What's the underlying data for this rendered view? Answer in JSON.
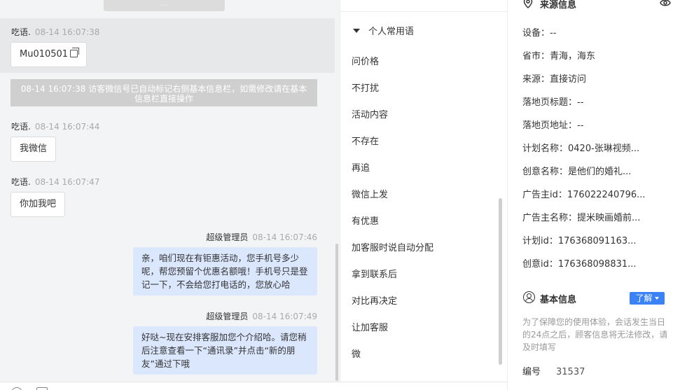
{
  "chat": {
    "top_pill": "...",
    "messages": [
      {
        "sender": "吃语.",
        "time": "08-14 16:07:38",
        "text": "Mu010501"
      },
      {
        "system": "08-14 16:07:38 访客微信号已自动标记右侧基本信息栏，如需修改请在基本信息栏直接操作"
      },
      {
        "sender": "吃语.",
        "time": "08-14 16:07:44",
        "text": "我微信"
      },
      {
        "sender": "吃语.",
        "time": "08-14 16:07:47",
        "text": "你加我吧"
      },
      {
        "sender": "超级管理员",
        "time": "08-14 16:07:46",
        "text": "亲，咱们现在有钜惠活动，您手机号多少呢，帮您预留个优惠名额哦！手机号只是登记一下，不会给您打电话的，您放心哈"
      },
      {
        "sender": "超级管理员",
        "time": "08-14 16:07:49",
        "text": "好哒~现在安排客服加您个介绍哈。请您稍后注意查看一下“通讯录”并点击“新的朋友”通过下哦"
      }
    ]
  },
  "phrases": {
    "group_title": "个人常用语",
    "items": [
      "问价格",
      "不打扰",
      "活动内容",
      "不存在",
      "再追",
      "微信上发",
      "有优惠",
      "加客服时说自动分配",
      "拿到联系后",
      "对比再决定",
      "让加客服",
      "微"
    ]
  },
  "info": {
    "source_title": "来源信息",
    "rows": [
      {
        "label": "设备：",
        "value": "--"
      },
      {
        "label": "省市：",
        "value": "青海，海东"
      },
      {
        "label": "来源：",
        "value": "直接访问"
      },
      {
        "label": "落地页标题：",
        "value": "--"
      },
      {
        "label": "落地页地址：",
        "value": "--"
      },
      {
        "label": "计划名称：",
        "value": "0420-张琳视频..."
      },
      {
        "label": "创意名称：",
        "value": "是他们的婚礼..."
      },
      {
        "label": "广告主id：",
        "value": "176022240796..."
      },
      {
        "label": "广告主名称：",
        "value": "提米映画婚前..."
      },
      {
        "label": "计划id：",
        "value": "176368091163..."
      },
      {
        "label": "创意id：",
        "value": "176368098831..."
      }
    ],
    "basic_title": "基本信息",
    "learn_label": "了解",
    "note": "为了保障您的使用体验，会话发生当日的24点之后，顾客信息将无法修改，请及时填写",
    "number_label": "编号",
    "number_value": "31537"
  },
  "colors": {
    "accent": "#3b82f6",
    "bubble_agent": "#dbe7fd",
    "chat_bg": "#f3f4f6",
    "system_note": "#cfcfcf"
  }
}
